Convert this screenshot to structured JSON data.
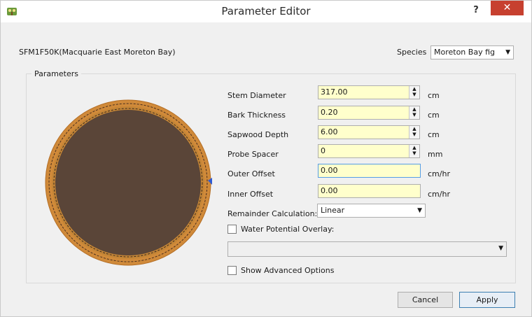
{
  "window": {
    "title": "Parameter Editor",
    "help_label": "?",
    "close_label": "✕"
  },
  "sensor": {
    "name": "SFM1F50K(Macquarie East Moreton Bay)"
  },
  "species": {
    "label": "Species",
    "value": "Moreton Bay fig"
  },
  "parameters": {
    "group_title": "Parameters",
    "stem_diameter": {
      "label": "Stem Diameter",
      "value": "317.00",
      "unit": "cm"
    },
    "bark_thickness": {
      "label": "Bark Thickness",
      "value": "0.20",
      "unit": "cm"
    },
    "sapwood_depth": {
      "label": "Sapwood Depth",
      "value": "6.00",
      "unit": "cm"
    },
    "probe_spacer": {
      "label": "Probe Spacer",
      "value": "0",
      "unit": "mm"
    },
    "outer_offset": {
      "label": "Outer Offset",
      "value": "0.00",
      "unit": "cm/hr"
    },
    "inner_offset": {
      "label": "Inner Offset",
      "value": "0.00",
      "unit": "cm/hr"
    },
    "remainder_calculation": {
      "label": "Remainder Calculation:",
      "value": "Linear"
    },
    "water_potential_overlay": {
      "label": "Water Potential Overlay:",
      "value": ""
    },
    "show_advanced_options": {
      "label": "Show Advanced Options"
    }
  },
  "buttons": {
    "cancel": "Cancel",
    "apply": "Apply"
  },
  "colors": {
    "bark": "#d08a3a",
    "sapwood": "#c48536",
    "heartwood": "#5a4538",
    "input_bg": "#ffffcc",
    "close": "#c7402f"
  }
}
